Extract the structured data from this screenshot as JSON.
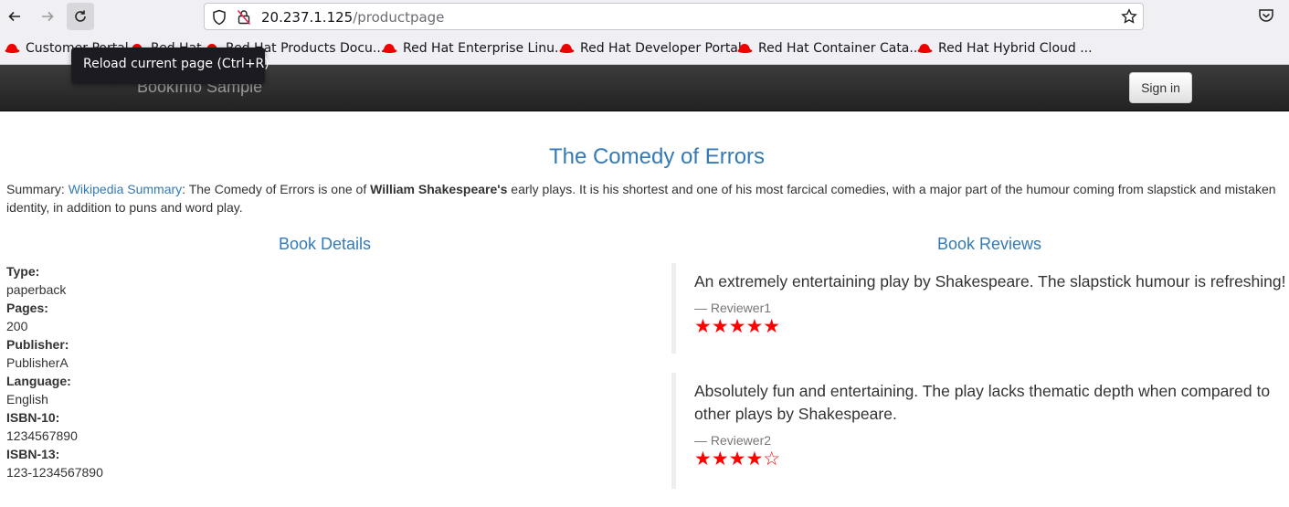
{
  "browser": {
    "url_host": "20.237.1.125",
    "url_path": "/productpage",
    "tooltip": "Reload current page (Ctrl+R)",
    "bookmarks": [
      "Customer Portal",
      "Red Hat",
      "Red Hat Products Docu...",
      "Red Hat Enterprise Linu...",
      "Red Hat Developer Portal",
      "Red Hat Container Cata...",
      "Red Hat Hybrid Cloud ..."
    ]
  },
  "navbar": {
    "brand": "BookInfo Sample",
    "signin": "Sign in"
  },
  "book": {
    "title": "The Comedy of Errors",
    "summary_prefix": "Summary: ",
    "summary_link": "Wikipedia Summary",
    "summary_mid": ": The Comedy of Errors is one of ",
    "summary_bold": "William Shakespeare's",
    "summary_rest": " early plays. It is his shortest and one of his most farcical comedies, with a major part of the humour coming from slapstick and mistaken identity, in addition to puns and word play."
  },
  "details": {
    "heading": "Book Details",
    "type_label": "Type:",
    "type": "paperback",
    "pages_label": "Pages:",
    "pages": "200",
    "publisher_label": "Publisher:",
    "publisher": "PublisherA",
    "language_label": "Language:",
    "language": "English",
    "isbn10_label": "ISBN-10:",
    "isbn10": "1234567890",
    "isbn13_label": "ISBN-13:",
    "isbn13": "123-1234567890"
  },
  "reviews": {
    "heading": "Book Reviews",
    "items": [
      {
        "text": "An extremely entertaining play by Shakespeare. The slapstick humour is refreshing!",
        "reviewer": "— Reviewer1",
        "rating": 5,
        "stars": "★★★★★"
      },
      {
        "text": "Absolutely fun and entertaining. The play lacks thematic depth when compared to other plays by Shakespeare.",
        "reviewer": "— Reviewer2",
        "rating": 4,
        "stars": "★★★★☆"
      }
    ]
  },
  "colors": {
    "link": "#337ab7",
    "star": "#ff0000",
    "navbar": "#222222"
  }
}
